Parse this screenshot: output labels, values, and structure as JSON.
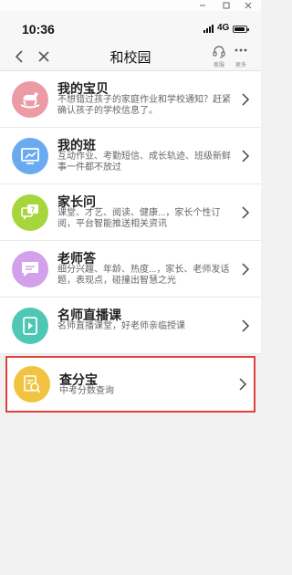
{
  "window": {
    "icons": [
      "minimize-icon",
      "maximize-icon",
      "close-icon"
    ]
  },
  "status": {
    "time": "10:36",
    "network": "4G",
    "battery_level": 0.9
  },
  "nav": {
    "title": "和校园",
    "service_label": "客服",
    "more_label": "更多"
  },
  "colors": {
    "card1": "#ec9ba5",
    "card2": "#6aaaf0",
    "card3": "#a6d63c",
    "card4": "#d3a0ec",
    "card5": "#4ec7b4",
    "card6": "#f1c340",
    "highlight": "#e0413e"
  },
  "items": [
    {
      "title": "我的宝贝",
      "line1": "不想错过孩子的家庭作业和学校通知？赶紧",
      "line2": "确认孩子的学校信息了。",
      "icon": "rocking-horse-icon"
    },
    {
      "title": "我的班",
      "line1": "互动作业、考勤短信、成长轨迹、班级新鲜",
      "line2": "事一件都不放过",
      "icon": "classroom-icon"
    },
    {
      "title": "家长问",
      "line1": "课堂、才艺、阅读、健康...，家长个性订",
      "line2": "阅，平台智能推送相关资讯",
      "icon": "question-chat-icon"
    },
    {
      "title": "老师答",
      "line1": "细分兴趣、年龄、热度...，家长、老师发话",
      "line2": "题，表现点，碰撞出智慧之光",
      "icon": "answer-chat-icon"
    },
    {
      "title": "名师直播课",
      "line1": "名师直播课堂，好老师亲临授课",
      "line2": "",
      "icon": "live-video-icon"
    },
    {
      "title": "查分宝",
      "line1": "中考分数查询",
      "line2": "",
      "icon": "score-search-icon"
    }
  ]
}
